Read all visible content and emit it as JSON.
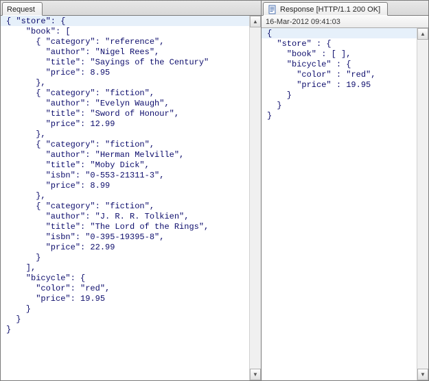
{
  "left": {
    "tab_label": "Request",
    "json_text": "{ \"store\": {\n    \"book\": [ \n      { \"category\": \"reference\",\n        \"author\": \"Nigel Rees\",\n        \"title\": \"Sayings of the Century\"\n        \"price\": 8.95\n      },\n      { \"category\": \"fiction\",\n        \"author\": \"Evelyn Waugh\",\n        \"title\": \"Sword of Honour\",\n        \"price\": 12.99\n      },\n      { \"category\": \"fiction\",\n        \"author\": \"Herman Melville\",\n        \"title\": \"Moby Dick\",\n        \"isbn\": \"0-553-21311-3\",\n        \"price\": 8.99\n      },\n      { \"category\": \"fiction\",\n        \"author\": \"J. R. R. Tolkien\",\n        \"title\": \"The Lord of the Rings\",\n        \"isbn\": \"0-395-19395-8\",\n        \"price\": 22.99\n      }\n    ],\n    \"bicycle\": {\n      \"color\": \"red\",\n      \"price\": 19.95\n    }\n  }\n}"
  },
  "right": {
    "tab_label": "Response [HTTP/1.1 200 OK]",
    "timestamp": "16-Mar-2012 09:41:03",
    "json_text": "{\n  \"store\" : {\n    \"book\" : [ ],\n    \"bicycle\" : {\n      \"color\" : \"red\",\n      \"price\" : 19.95\n    }\n  }\n}"
  }
}
